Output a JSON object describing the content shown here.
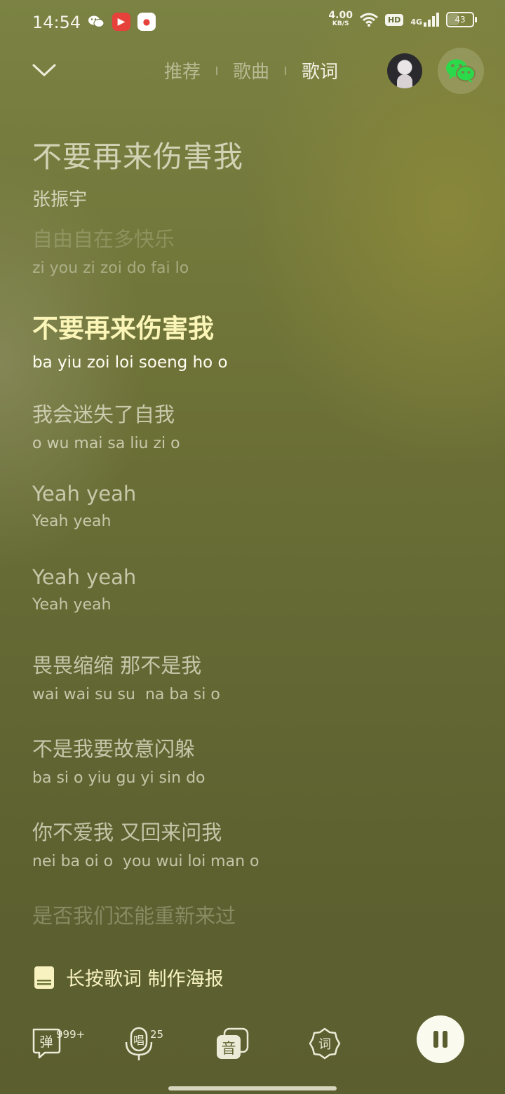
{
  "status_bar": {
    "time": "14:54",
    "net_speed": "4.00",
    "net_unit": "KB/S",
    "hd_label": "HD",
    "network": "4G",
    "battery": "43"
  },
  "header": {
    "tabs": [
      {
        "label": "推荐",
        "active": false
      },
      {
        "label": "歌曲",
        "active": false
      },
      {
        "label": "歌词",
        "active": true
      }
    ]
  },
  "song": {
    "title": "不要再来伤害我",
    "artist": "张振宇"
  },
  "lyrics": [
    {
      "main": "自由自在多快乐",
      "roman": "zi you zi zoi do fai lo"
    },
    {
      "main": "不要再来伤害我",
      "roman": "ba yiu zoi loi soeng ho o"
    },
    {
      "main": "我会迷失了自我",
      "roman": "o wu mai sa liu zi o"
    },
    {
      "main": "Yeah yeah",
      "roman": "Yeah yeah"
    },
    {
      "main": "Yeah yeah",
      "roman": "Yeah yeah"
    },
    {
      "main": "畏畏缩缩 那不是我",
      "roman": "wai wai su su  na ba si o"
    },
    {
      "main": "不是我要故意闪躲",
      "roman": "ba si o yiu gu yi sin do"
    },
    {
      "main": "你不爱我 又回来问我",
      "roman": "nei ba oi o  you wui loi man o"
    },
    {
      "main": "是否我们还能重新来过",
      "roman": ""
    }
  ],
  "poster_hint": "长按歌词 制作海报",
  "controls": {
    "danmu_label": "弹",
    "danmu_count": "999+",
    "sing_label": "唱",
    "sing_count": "25",
    "sound_label": "音",
    "lyric_label": "词"
  },
  "colors": {
    "current_lyric": "#fbf6b8",
    "wechat_green": "#2bd94a"
  }
}
